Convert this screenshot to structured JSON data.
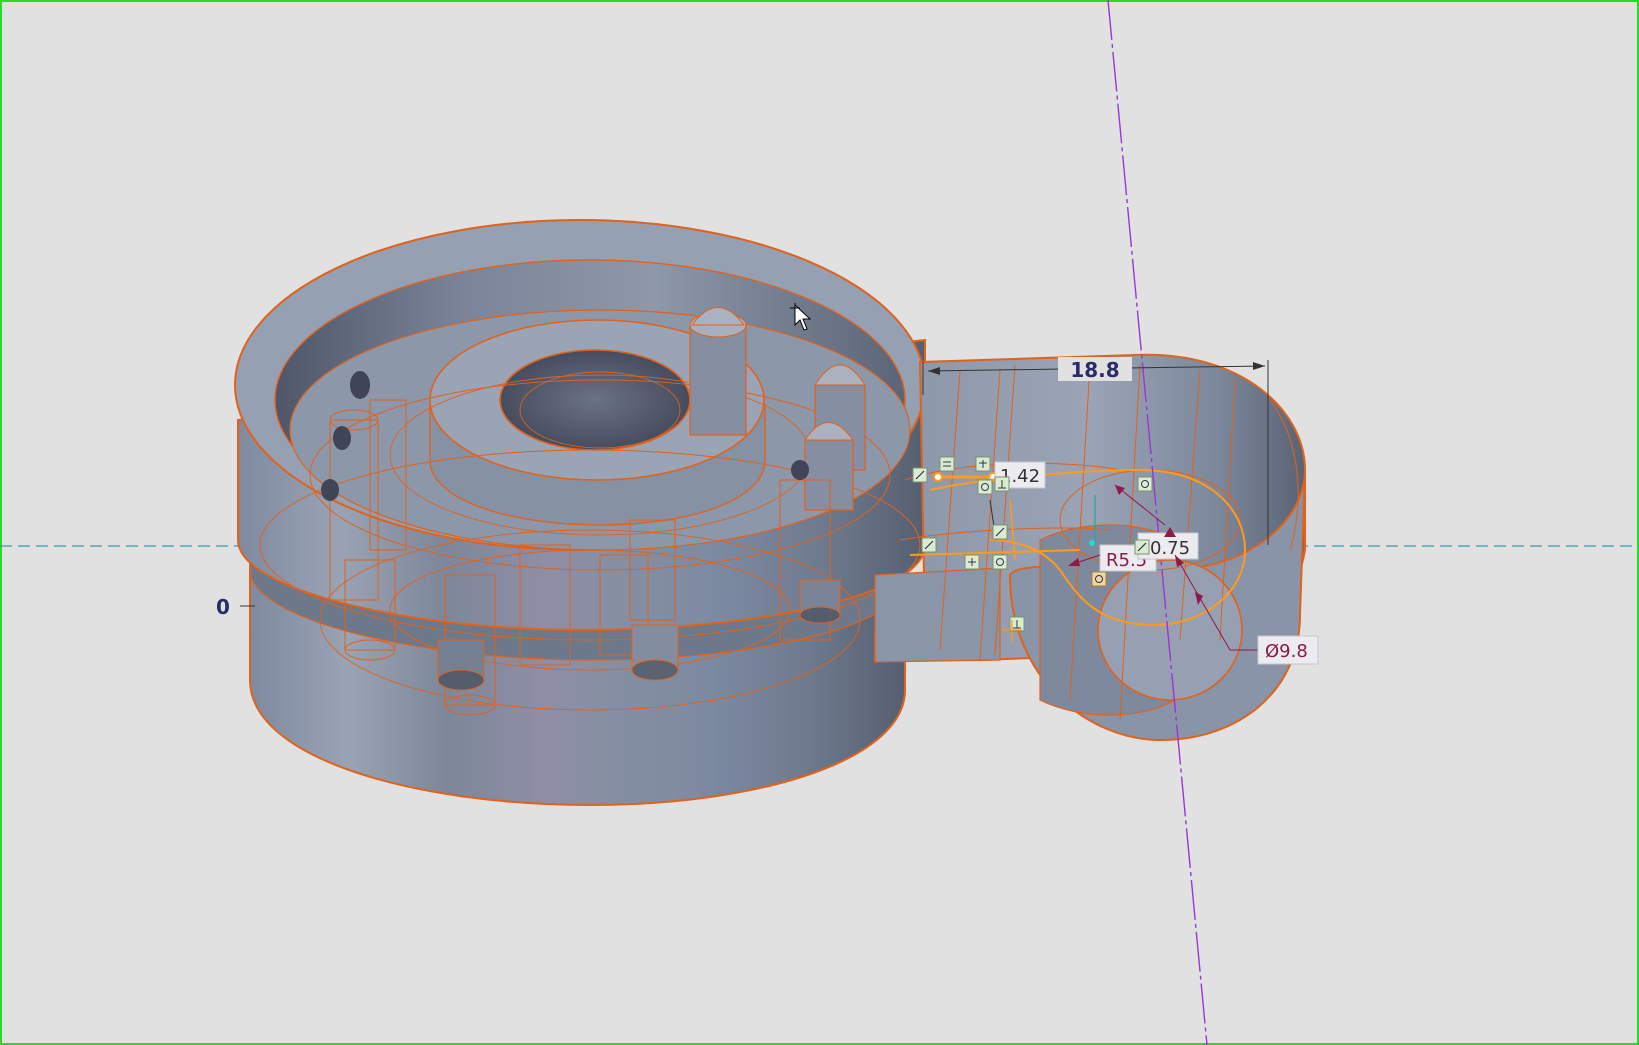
{
  "viewport": {
    "background": "#e1e1e1",
    "frame_color": "#22dd22",
    "model_color": "#8c97a8",
    "edge_color": "#e0621b",
    "sketch_color": "#ff9a1a",
    "dimension_color": "#8e1a4a",
    "axis_color": "#9b35d6",
    "centerline_color": "#3c9aa0"
  },
  "dimensions": {
    "length": "18.8",
    "offset": "1.42",
    "radius": "R5.5",
    "small_value": "0.75",
    "diameter": "Ø9.8",
    "origin_label": "0"
  },
  "constraint_icons": [
    "tangent-constraint-icon",
    "equal-constraint-icon",
    "parallel-constraint-icon",
    "perpendicular-constraint-icon",
    "coincident-constraint-icon"
  ],
  "cursor": "move-cursor-icon"
}
